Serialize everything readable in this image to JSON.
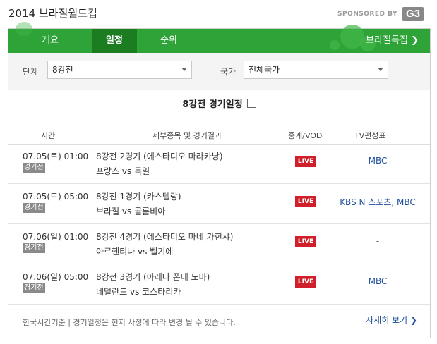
{
  "header": {
    "title": "2014 브라질월드컵",
    "sponsor_label": "SPONSORED BY",
    "sponsor_logo": "G3"
  },
  "tabs": [
    {
      "label": "개요"
    },
    {
      "label": "일정"
    },
    {
      "label": "순위"
    }
  ],
  "special_link": "브라질특집 ❯",
  "filters": {
    "stage_label": "단계",
    "stage_value": "8강전",
    "country_label": "국가",
    "country_value": "전체국가"
  },
  "schedule_title": "8강전 경기일정",
  "columns": {
    "time": "시간",
    "detail": "세부종목 및 경기결과",
    "broadcast": "중계/VOD",
    "tv": "TV편성표"
  },
  "matches": [
    {
      "time": "07.05(토) 01:00",
      "status": "경기전",
      "event": "8강전 2경기 (에스타디오 마라카낭)",
      "teams": "프랑스 vs 독일",
      "live": "LIVE",
      "tv": "MBC"
    },
    {
      "time": "07.05(토) 05:00",
      "status": "경기전",
      "event": "8강전 1경기 (카스텔랑)",
      "teams": "브라질 vs 콜롬비아",
      "live": "LIVE",
      "tv": "KBS N 스포츠, MBC"
    },
    {
      "time": "07.06(일) 01:00",
      "status": "경기전",
      "event": "8강전 4경기 (에스타디오 마네 가힌샤)",
      "teams": "아르헨티나 vs 벨기에",
      "live": "LIVE",
      "tv": "-"
    },
    {
      "time": "07.06(일) 05:00",
      "status": "경기전",
      "event": "8강전 3경기 (아레나 폰테 노바)",
      "teams": "네덜란드 vs 코스타리카",
      "live": "LIVE",
      "tv": "MBC"
    }
  ],
  "footer": {
    "note": "한국시간기준 | 경기일정은 현지 사정에 따라 변경 될 수 있습니다.",
    "more": "자세히 보기 ❯"
  }
}
